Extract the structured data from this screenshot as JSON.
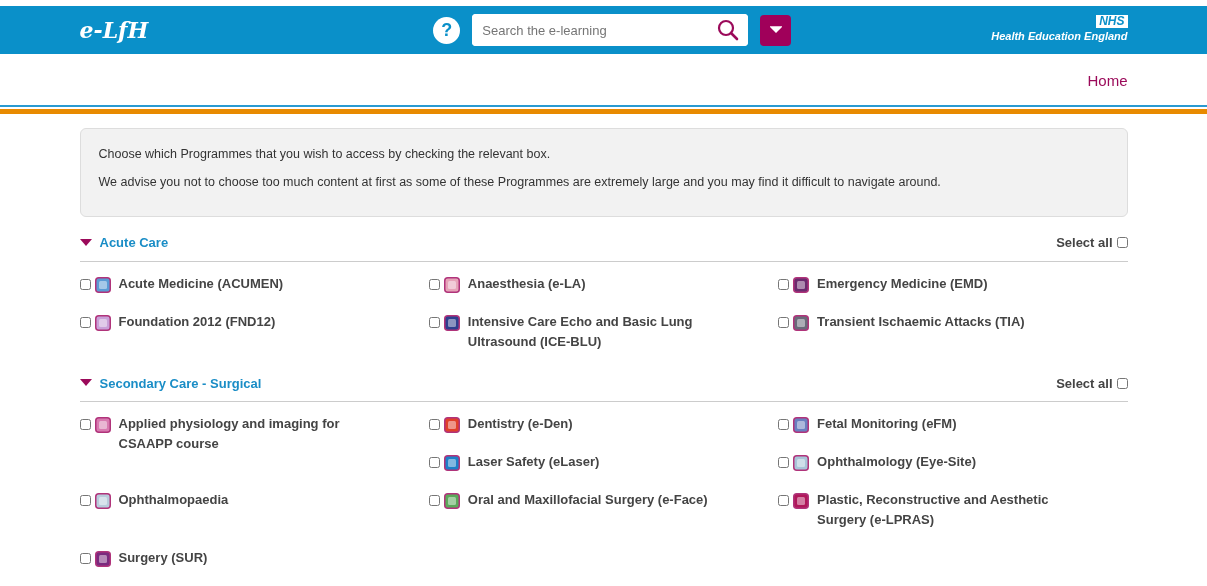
{
  "header": {
    "logo": "e-LfH",
    "help": "?",
    "search": {
      "placeholder": "Search the e-learning"
    },
    "nhs_badge": "NHS",
    "organisation": "Health Education England"
  },
  "nav": {
    "links": [
      "Home"
    ]
  },
  "intro": [
    "Choose which Programmes that you wish to access by checking the relevant box.",
    "We advise you not to choose too much content at first as some of these Programmes are extremely large and you may find it difficult to navigate around."
  ],
  "sections": [
    {
      "title": "Acute Care",
      "expanded": true,
      "select_all": {
        "label": "Select all",
        "checked": false
      },
      "items": [
        {
          "label": "Acute Medicine (ACUMEN)",
          "checked": false,
          "color": "#5b9bd5"
        },
        {
          "label": "Anaesthesia (e-LA)",
          "checked": false,
          "color": "#e6a3b8"
        },
        {
          "label": "Emergency Medicine (EMD)",
          "checked": false,
          "color": "#6b2a6e"
        },
        {
          "label": "Foundation 2012 (FND12)",
          "checked": false,
          "color": "#c9a0d8"
        },
        {
          "label": "Intensive Care Echo and Basic Lung Ultrasound (ICE-BLU)",
          "checked": false,
          "color": "#2e3f8f"
        },
        {
          "label": "Transient Ischaemic Attacks (TIA)",
          "checked": false,
          "color": "#6a6a7a"
        }
      ]
    },
    {
      "title": "Secondary Care - Surgical",
      "expanded": true,
      "select_all": {
        "label": "Select all",
        "checked": false
      },
      "items": [
        {
          "label": "Applied physiology and imaging for CSAAPP course",
          "checked": false,
          "color": "#d87ab0"
        },
        {
          "label": "Dentistry (e-Den)",
          "checked": false,
          "color": "#e0402a"
        },
        {
          "label": "Fetal Monitoring (eFM)",
          "checked": false,
          "color": "#6a7fc0"
        },
        {
          "label": "Laser Safety (eLaser)",
          "checked": false,
          "color": "#1e7fc8"
        },
        {
          "label": "Ophthalmology (Eye-Site)",
          "checked": false,
          "color": "#a8c4d8"
        },
        {
          "label": "Ophthalmopaedia",
          "checked": false,
          "color": "#b8ccdc"
        },
        {
          "label": "Oral and Maxillofacial Surgery (e-Face)",
          "checked": false,
          "color": "#5aa85a"
        },
        {
          "label": "Plastic, Reconstructive and Aesthetic Surgery (e-LPRAS)",
          "checked": false,
          "color": "#b0185a"
        },
        {
          "label": "Surgery (SUR)",
          "checked": false,
          "color": "#7a2a7e"
        }
      ]
    }
  ]
}
